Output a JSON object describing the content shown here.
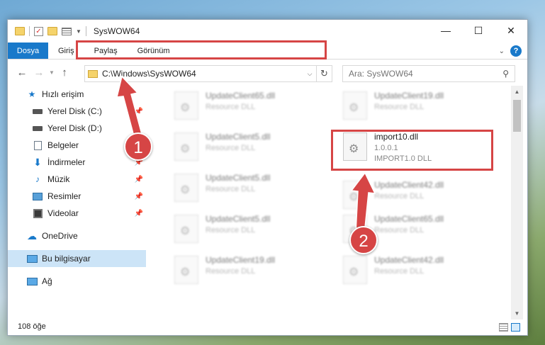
{
  "window": {
    "title": "SysWOW64",
    "controls": {
      "minimize": "—",
      "maximize": "☐",
      "close": "✕"
    }
  },
  "ribbon": {
    "tabs": [
      "Dosya",
      "Giriş",
      "Paylaş",
      "Görünüm"
    ],
    "help": "?"
  },
  "nav": {
    "back": "←",
    "forward": "→",
    "up": "↑",
    "address": "C:\\Windows\\SysWOW64",
    "refresh": "↻",
    "search_placeholder": "Ara: SysWOW64"
  },
  "sidebar": {
    "quick_access": "Hızlı erişim",
    "items": [
      {
        "label": "Yerel Disk (C:)",
        "icon": "disk-icon",
        "pinned": true
      },
      {
        "label": "Yerel Disk (D:)",
        "icon": "disk-icon",
        "pinned": false
      },
      {
        "label": "Belgeler",
        "icon": "document-icon",
        "pinned": true
      },
      {
        "label": "İndirmeler",
        "icon": "download-icon",
        "pinned": true
      },
      {
        "label": "Müzik",
        "icon": "music-icon",
        "pinned": true
      },
      {
        "label": "Resimler",
        "icon": "pictures-icon",
        "pinned": true
      },
      {
        "label": "Videolar",
        "icon": "videos-icon",
        "pinned": true
      }
    ],
    "onedrive": "OneDrive",
    "this_pc": "Bu bilgisayar",
    "network": "Ağ"
  },
  "files": [
    {
      "name": "UpdateClient65.dll",
      "type": "Resource DLL"
    },
    {
      "name": "UpdateClient19.dll",
      "type": "Resource DLL"
    },
    {
      "name": "UpdateClient5.dll",
      "type": "Resource DLL"
    },
    {
      "name": "import10.dll",
      "version": "1.0.0.1",
      "type": "IMPORT1.0 DLL"
    },
    {
      "name": "UpdateClient5.dll",
      "type": "Resource DLL"
    },
    {
      "name": "UpdateClient42.dll",
      "type": "Resource DLL"
    },
    {
      "name": "UpdateClient5.dll",
      "type": "Resource DLL"
    },
    {
      "name": "UpdateClient65.dll",
      "type": "Resource DLL"
    },
    {
      "name": "UpdateClient19.dll",
      "type": "Resource DLL"
    },
    {
      "name": "UpdateClient42.dll",
      "type": "Resource DLL"
    }
  ],
  "status": {
    "count": "108 öğe"
  },
  "annotations": {
    "step1": "1",
    "step2": "2"
  },
  "colors": {
    "accent": "#1979ca",
    "highlight": "#d64545",
    "selected": "#cce4f7"
  }
}
